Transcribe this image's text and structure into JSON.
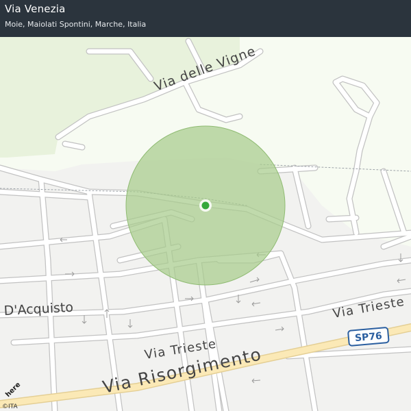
{
  "header": {
    "title": "Via Venezia",
    "subtitle": "Moie, Maiolati Spontini, Marche, Italia"
  },
  "map": {
    "streets": [
      {
        "id": "via-delle-vigne",
        "label": "Via delle Vigne"
      },
      {
        "id": "via-risorgimento",
        "label": "Via Risorgimento"
      },
      {
        "id": "via-trieste-left",
        "label": "Via Trieste"
      },
      {
        "id": "via-trieste-right",
        "label": "Via Trieste"
      },
      {
        "id": "via-dacquisto",
        "label": "D'Acquisto"
      }
    ],
    "road_shield": "SP76",
    "colors": {
      "background": "#f2f2f0",
      "park": "#e8f2dc",
      "road": "#ffffff",
      "road_casing": "#b7b7b7",
      "main_road": "#fbe9b6",
      "accuracy_circle": "#a8cc8c",
      "marker": "#35a93b",
      "header": "#2b343d"
    }
  },
  "logo": "here",
  "attribution": "©ITA"
}
